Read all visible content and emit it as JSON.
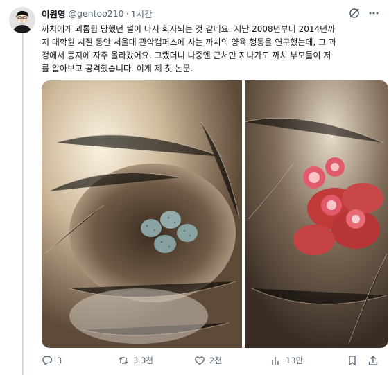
{
  "tweet": {
    "author_name": "이원영",
    "author_handle": "@gentoo210",
    "separator": "·",
    "time": "1시간",
    "text_lines": [
      "까치에게 괴롭힘 당했던 썰이 다시 회자되는 것 같네요. 지난 2008년부터 2014년까",
      "지 대학원 시절 동안 서울대 관악캠퍼스에 사는 까치의 양육 행동을 연구했는데, 그 과",
      "정에서 둥지에 자주 올라갔어요. 그랬더니 나중엔 근처만 지나가도 까치 부모들이 저",
      "를 알아보고 공격했습니다. 이게 제 첫 논문."
    ]
  },
  "actions": {
    "replies": "3",
    "reposts": "3.3천",
    "likes": "2천",
    "views": "13만"
  },
  "colors": {
    "text": "#0f1419",
    "secondary": "#536471",
    "divider": "#cfd9de"
  }
}
